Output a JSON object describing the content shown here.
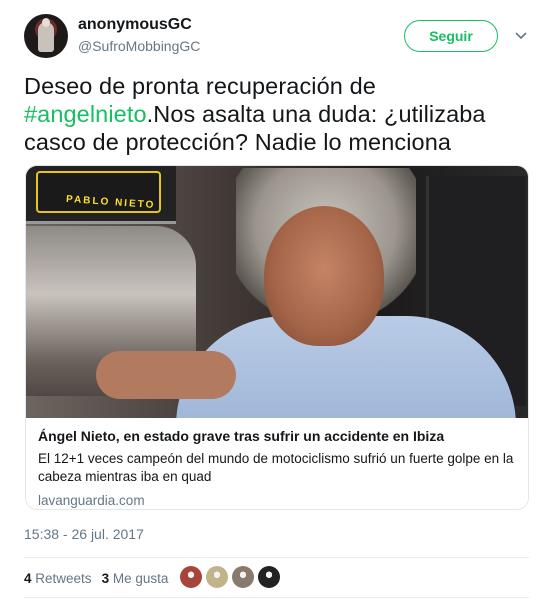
{
  "user": {
    "name": "anonymousGC",
    "handle": "@SufroMobbingGC",
    "follow_label": "Seguir"
  },
  "tweet": {
    "text_before": "Deseo de pronta recuperación de ",
    "hashtag": "#angelnieto",
    "text_after": ".Nos asalta una duda: ¿utilizaba casco de protección? Nadie lo menciona"
  },
  "card": {
    "image_plate_text": "PABLO NIETO",
    "title": "Ángel Nieto, en estado grave tras sufrir un accidente en Ibiza",
    "description": "El 12+1 veces campeón del mundo de motociclismo sufrió un fuerte golpe en la cabeza mientras iba en quad",
    "domain": "lavanguardia.com"
  },
  "meta": {
    "timestamp": "15:38 - 26 jul. 2017",
    "retweets_count": "4",
    "retweets_label": "Retweets",
    "likes_count": "3",
    "likes_label": "Me gusta"
  },
  "likers": [
    {
      "icon": "avatar-1",
      "color": "#a8453a"
    },
    {
      "icon": "avatar-2",
      "color": "#c2b48a"
    },
    {
      "icon": "avatar-3",
      "color": "#8a7a6e"
    },
    {
      "icon": "avatar-4",
      "color": "#222222"
    }
  ],
  "colors": {
    "accent": "#17bf63",
    "secondary_text": "#657786",
    "border": "#e1e8ed"
  }
}
